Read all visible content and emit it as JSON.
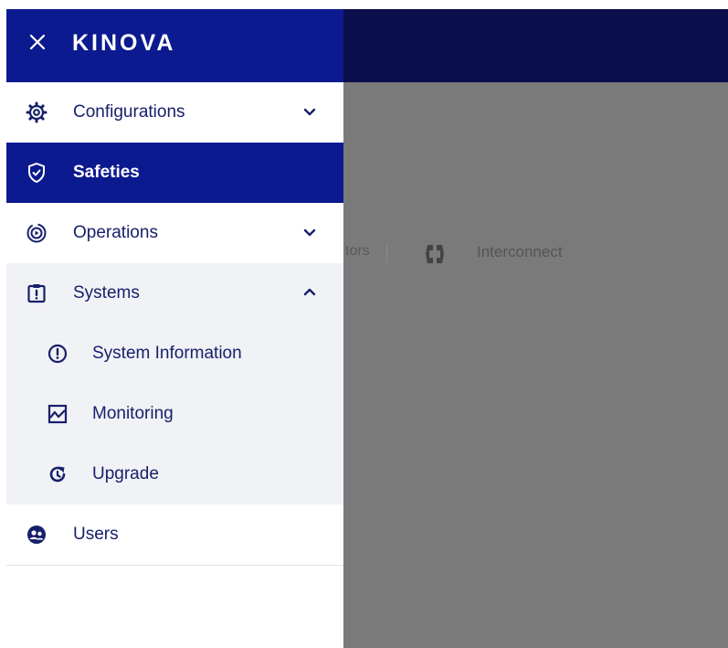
{
  "brand": {
    "logo_text": "KINOVA"
  },
  "drawer": {
    "items": [
      {
        "label": "Configurations",
        "icon": "gear-icon",
        "chevron": "chevron-down-icon"
      },
      {
        "label": "Safeties",
        "icon": "shield-check-icon",
        "active": true
      },
      {
        "label": "Operations",
        "icon": "operations-icon",
        "chevron": "chevron-down-icon"
      },
      {
        "label": "Systems",
        "icon": "clipboard-alert-icon",
        "chevron": "chevron-up-icon",
        "expanded": true
      },
      {
        "label": "Users",
        "icon": "users-icon"
      }
    ],
    "system_subitems": [
      {
        "label": "System Information",
        "icon": "info-circle-icon"
      },
      {
        "label": "Monitoring",
        "icon": "chart-icon"
      },
      {
        "label": "Upgrade",
        "icon": "refresh-icon"
      }
    ]
  },
  "background": {
    "partial_tab": "tors",
    "tab_label": "Interconnect"
  },
  "colors": {
    "brand_navy": "#0c1a8f",
    "text_navy": "#17206a",
    "overlay_gray": "#7a7a7a",
    "app_header": "#0a0e4a"
  }
}
